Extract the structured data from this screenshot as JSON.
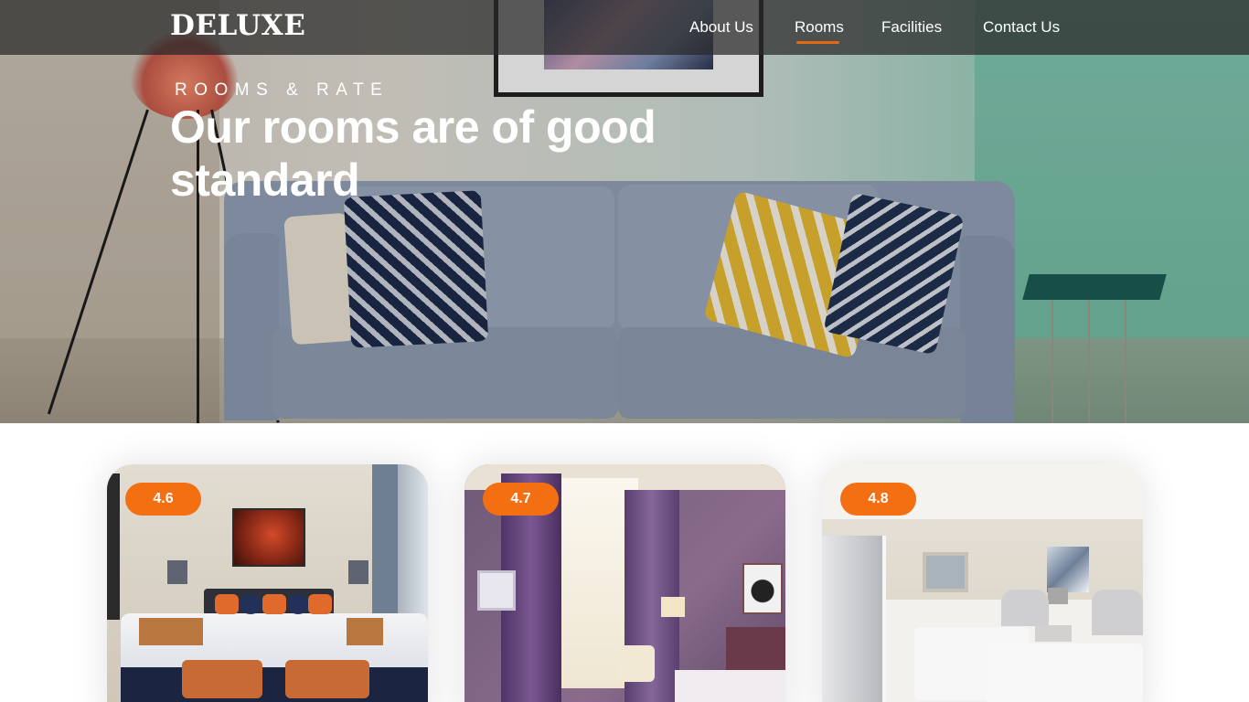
{
  "brand": {
    "logo_text": "DELUXE"
  },
  "nav": {
    "items": [
      {
        "label": "About Us",
        "active": false
      },
      {
        "label": "Rooms",
        "active": true
      },
      {
        "label": "Facilities",
        "active": false
      },
      {
        "label": "Contact Us",
        "active": false
      }
    ],
    "active_color": "#e46a14"
  },
  "hero": {
    "kicker": "ROOMS & RATE",
    "title": "Our rooms are of good standard"
  },
  "rooms": [
    {
      "rating": "4.6"
    },
    {
      "rating": "4.7"
    },
    {
      "rating": "4.8"
    }
  ],
  "colors": {
    "accent": "#f46e12",
    "nav_background": "#282828"
  }
}
